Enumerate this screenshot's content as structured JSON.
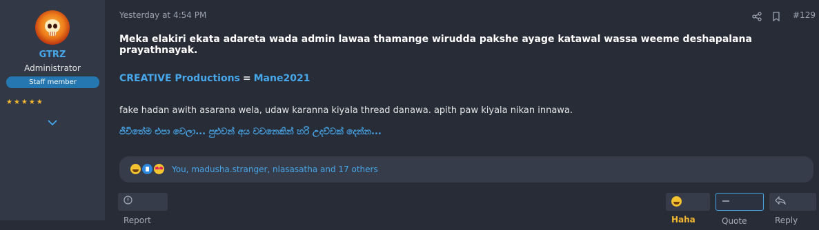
{
  "user": {
    "name": "GTRZ",
    "title": "Administrator",
    "badge": "Staff member",
    "stars": "★★★★★",
    "avatar_icon": "flaming-skull-avatar",
    "expand_icon": "chevron-down-icon"
  },
  "meta": {
    "date": "Yesterday at 4:54 PM",
    "post_number": "#129"
  },
  "content": {
    "bold_line": "Meka elakiri ekata adareta wada admin lawaa thamange wirudda pakshe ayage katawal wassa weeme deshapalana prayathnayak.",
    "signature": {
      "left": "CREATIVE Productions",
      "equals": "=",
      "right": "Mane2021"
    },
    "body_line": "fake hadan awith asarana wela, udaw karanna kiyala thread danawa. apith paw kiyala nikan innawa.",
    "sinhala_line": "ජීවිතේම එපා වෙලා... පුළුවන් අය වචනෙකින් හරි උදව්වක් දෙන්න..."
  },
  "reactions": {
    "icons": [
      "haha",
      "like",
      "love"
    ],
    "text": "You, madusha.stranger, nlasasatha and 17 others"
  },
  "actions": {
    "report": "Report",
    "haha": "Haha",
    "quote": "Quote",
    "reply": "Reply"
  },
  "colors": {
    "background": "#282c37",
    "sidebar": "#323846",
    "link": "#47a7eb",
    "staff_badge": "#2577b1",
    "star": "#f5b82e"
  }
}
